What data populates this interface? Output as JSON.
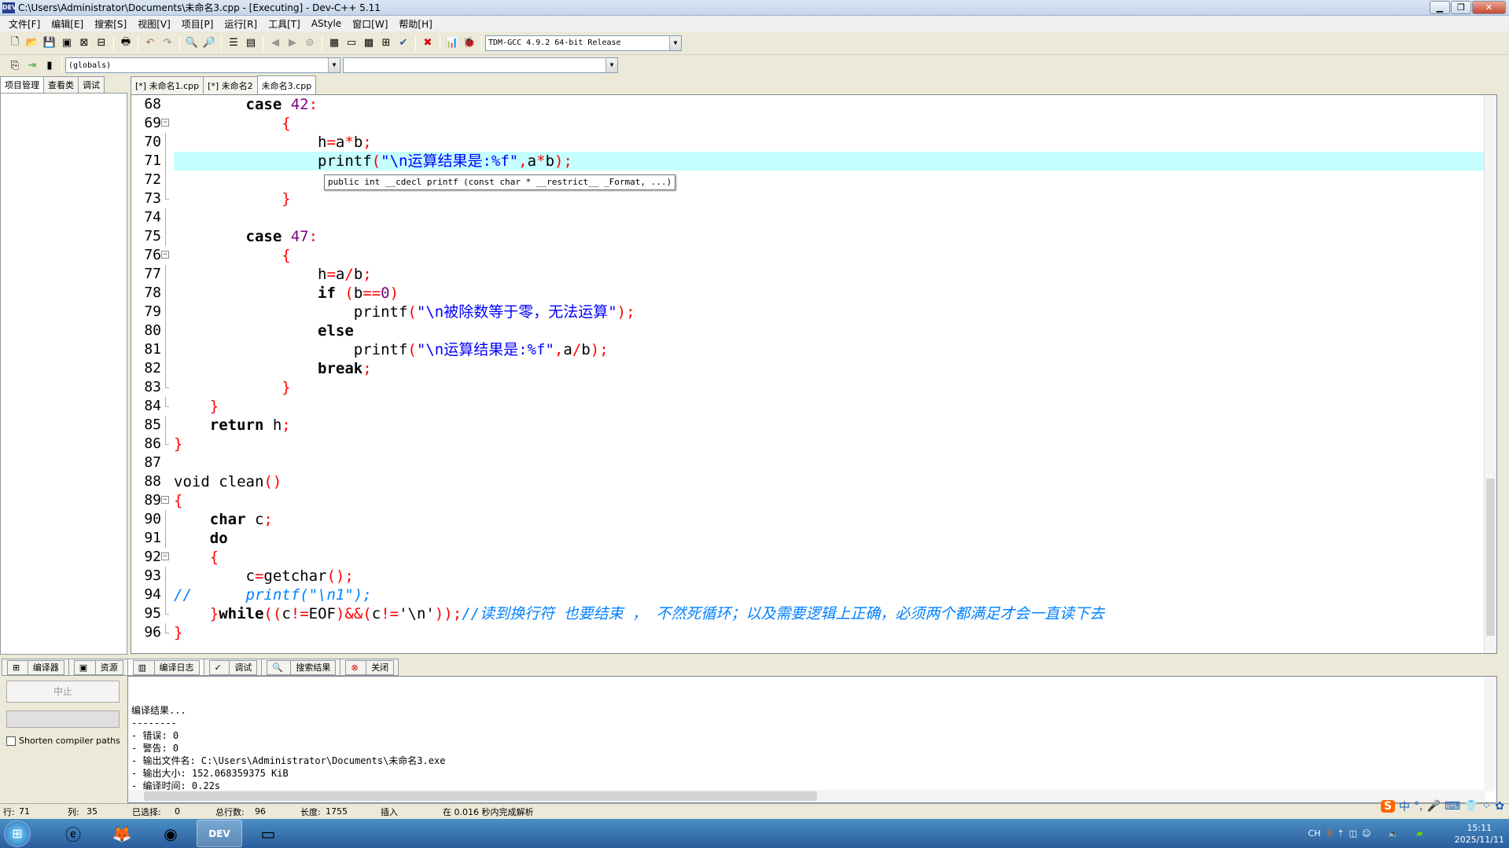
{
  "window": {
    "title": "C:\\Users\\Administrator\\Documents\\未命名3.cpp - [Executing] - Dev-C++ 5.11",
    "app_icon": "DEV"
  },
  "menu": [
    "文件[F]",
    "编辑[E]",
    "搜索[S]",
    "视图[V]",
    "项目[P]",
    "运行[R]",
    "工具[T]",
    "AStyle",
    "窗口[W]",
    "帮助[H]"
  ],
  "toolbar": {
    "compiler": "TDM-GCC 4.9.2 64-bit Release",
    "scope": "(globals)",
    "scope2": ""
  },
  "left_tabs": [
    "项目管理",
    "查看类",
    "调试"
  ],
  "editor_tabs": [
    "[*] 未命名1.cpp",
    "[*] 未命名2",
    "未命名3.cpp"
  ],
  "editor": {
    "lines": [
      {
        "n": "68",
        "fold": "",
        "html": "        <b>case</b> <span class=\"p\">42</span><span class=\"r\">:</span>"
      },
      {
        "n": "69",
        "fold": "box",
        "html": "            <span class=\"r\">{</span>"
      },
      {
        "n": "70",
        "fold": "bar",
        "html": "                h<span class=\"r\">=</span>a<span class=\"r\">*</span>b<span class=\"r\">;</span>"
      },
      {
        "n": "71",
        "fold": "bar",
        "hl": true,
        "html": "                printf<span class=\"r\">(</span><span class=\"s\">\"\\n运算结果是:%f\"</span><span class=\"r\">,</span>a<span class=\"r\">*</span>b<span class=\"r\">);</span>"
      },
      {
        "n": "72",
        "fold": "bar",
        "html": ""
      },
      {
        "n": "73",
        "fold": "end",
        "html": "            <span class=\"r\">}</span>"
      },
      {
        "n": "74",
        "fold": "bar",
        "html": ""
      },
      {
        "n": "75",
        "fold": "bar",
        "html": "        <b>case</b> <span class=\"p\">47</span><span class=\"r\">:</span>"
      },
      {
        "n": "76",
        "fold": "box",
        "html": "            <span class=\"r\">{</span>"
      },
      {
        "n": "77",
        "fold": "bar",
        "html": "                h<span class=\"r\">=</span>a<span class=\"r\">/</span>b<span class=\"r\">;</span>"
      },
      {
        "n": "78",
        "fold": "bar",
        "html": "                <b>if</b> <span class=\"r\">(</span>b<span class=\"r\">==</span><span class=\"p\">0</span><span class=\"r\">)</span>"
      },
      {
        "n": "79",
        "fold": "bar",
        "html": "                    printf<span class=\"r\">(</span><span class=\"s\">\"\\n被除数等于零，无法运算\"</span><span class=\"r\">);</span>"
      },
      {
        "n": "80",
        "fold": "bar",
        "html": "                <b>else</b>"
      },
      {
        "n": "81",
        "fold": "bar",
        "html": "                    printf<span class=\"r\">(</span><span class=\"s\">\"\\n运算结果是:%f\"</span><span class=\"r\">,</span>a<span class=\"r\">/</span>b<span class=\"r\">);</span>"
      },
      {
        "n": "82",
        "fold": "bar",
        "html": "                <b>break</b><span class=\"r\">;</span>"
      },
      {
        "n": "83",
        "fold": "end",
        "html": "            <span class=\"r\">}</span>"
      },
      {
        "n": "84",
        "fold": "end",
        "html": "    <span class=\"r\">}</span>"
      },
      {
        "n": "85",
        "fold": "bar",
        "html": "    <b>return</b> h<span class=\"r\">;</span>"
      },
      {
        "n": "86",
        "fold": "end",
        "html": "<span class=\"r\">}</span>"
      },
      {
        "n": "87",
        "fold": "",
        "html": ""
      },
      {
        "n": "88",
        "fold": "",
        "html": "void clean<span class=\"r\">()</span>"
      },
      {
        "n": "89",
        "fold": "box",
        "html": "<span class=\"r\">{</span>"
      },
      {
        "n": "90",
        "fold": "bar",
        "html": "    <b>char</b> c<span class=\"r\">;</span>"
      },
      {
        "n": "91",
        "fold": "bar",
        "html": "    <b>do</b>"
      },
      {
        "n": "92",
        "fold": "box",
        "html": "    <span class=\"r\">{</span>"
      },
      {
        "n": "93",
        "fold": "bar",
        "html": "        c<span class=\"r\">=</span>getchar<span class=\"r\">();</span>"
      },
      {
        "n": "94",
        "fold": "bar",
        "html": "<span class=\"c\">//      printf(\"\\n1\");</span>"
      },
      {
        "n": "95",
        "fold": "end",
        "html": "    <span class=\"r\">}</span><b>while</b><span class=\"r\">((</span>c<span class=\"r\">!=</span>EOF<span class=\"r\">)&amp;&amp;(</span>c<span class=\"r\">!=</span>'\\n'<span class=\"r\">));</span><span class=\"c\">//读到换行符 也要结束 ， 不然死循环；以及需要逻辑上正确，必须两个都满足才会一直读下去</span>"
      },
      {
        "n": "96",
        "fold": "end",
        "html": "<span class=\"r\">}</span>"
      }
    ],
    "tooltip": "public int __cdecl printf (const char * __restrict__ _Format, ...)"
  },
  "bottom_tabs": [
    "编译器",
    "资源",
    "编译日志",
    "调试",
    "搜索结果",
    "关闭"
  ],
  "bottom_left": {
    "stop_label": "中止",
    "checkbox_label": "Shorten compiler paths"
  },
  "log": "编译结果...\n--------\n- 错误: 0\n- 警告: 0\n- 输出文件名: C:\\Users\\Administrator\\Documents\\未命名3.exe\n- 输出大小: 152.068359375 KiB\n- 编译时间: 0.22s",
  "status": {
    "row_label": "行:",
    "row": "71",
    "col_label": "列:",
    "col": "35",
    "sel_label": "已选择:",
    "sel": "0",
    "total_label": "总行数:",
    "total": "96",
    "len_label": "长度:",
    "len": "1755",
    "mode": "插入",
    "parse": "在 0.016 秒内完成解析"
  },
  "taskbar": {
    "time": "15:11",
    "date": "2025/11/11",
    "lang": "CH"
  },
  "ime": [
    "S",
    "中",
    "°,",
    "🎤",
    "⌨",
    "👕",
    "⁘",
    "✿"
  ]
}
